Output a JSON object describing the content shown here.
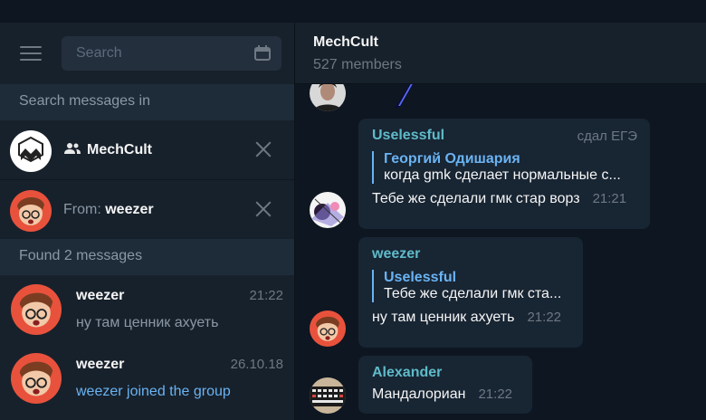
{
  "search": {
    "placeholder": "Search"
  },
  "sidebar": {
    "search_in_label": "Search messages in",
    "chat_filter": {
      "name": "MechCult"
    },
    "from_filter": {
      "prefix": "From: ",
      "user": "weezer"
    },
    "found_label": "Found 2 messages",
    "results": [
      {
        "name": "weezer",
        "time": "21:22",
        "text": "ну там ценник ахуеть"
      },
      {
        "name": "weezer",
        "time": "26.10.18",
        "text": "weezer joined the group"
      }
    ]
  },
  "chat": {
    "title": "MechCult",
    "subtitle": "527 members",
    "messages": [
      {
        "author": "Uselessful",
        "badge": "сдал ЕГЭ",
        "reply_author": "Георгий Одишария",
        "reply_text": "когда gmk сделает нормальные с...",
        "text": "Тебе же сделали гмк стар ворз",
        "time": "21:21"
      },
      {
        "author": "weezer",
        "reply_author": "Uselessful",
        "reply_text": "Тебе же сделали гмк ста...",
        "text": "ну там ценник ахуеть",
        "time": "21:22"
      },
      {
        "author": "Alexander",
        "text": "Мандалориан",
        "time": "21:22"
      }
    ]
  },
  "colors": {
    "accent": "#6ab3f3",
    "author_name": "#5fbbc9",
    "panel": "#17212b",
    "chat_bg": "#0e1621",
    "bubble": "#182533"
  }
}
